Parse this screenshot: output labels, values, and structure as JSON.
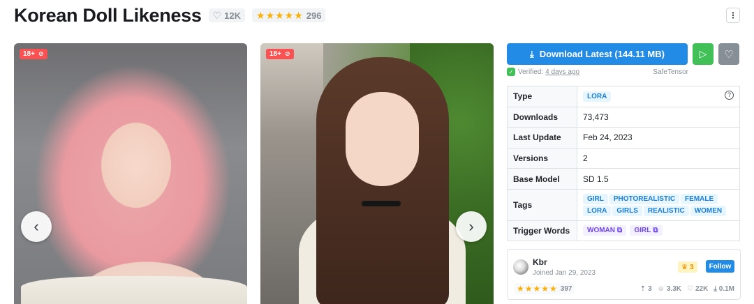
{
  "model": {
    "title": "Korean Doll Likeness",
    "likes": "12K",
    "rating_stars": "★★★★★",
    "rating_count": "296"
  },
  "gallery": {
    "nsfw_label": "18+"
  },
  "download": {
    "label": "Download Latest (144.11 MB)",
    "verified_prefix": "Verified:",
    "verified_time": "4 days ago",
    "format": "SafeTensor"
  },
  "details": {
    "type_label": "Type",
    "type_value": "LORA",
    "downloads_label": "Downloads",
    "downloads_value": "73,473",
    "last_update_label": "Last Update",
    "last_update_value": "Feb 24, 2023",
    "versions_label": "Versions",
    "versions_value": "2",
    "base_model_label": "Base Model",
    "base_model_value": "SD 1.5",
    "tags_label": "Tags",
    "tags": [
      "GIRL",
      "PHOTOREALISTIC",
      "FEMALE",
      "LORA",
      "GIRLS",
      "REALISTIC",
      "WOMEN"
    ],
    "trigger_label": "Trigger Words",
    "trigger_words": [
      "WOMAN",
      "GIRL"
    ]
  },
  "creator": {
    "name": "Kbr",
    "joined": "Joined Jan 29, 2023",
    "rank": "3",
    "follow_label": "Follow",
    "rating_stars": "★★★★★",
    "rating_count": "397",
    "uploads": "3",
    "followers": "3.3K",
    "likes": "22K",
    "downloads": "0.1M"
  },
  "colors": {
    "primary": "#228be6",
    "success": "#40c057",
    "danger": "#fa5252",
    "star": "#fab005"
  }
}
